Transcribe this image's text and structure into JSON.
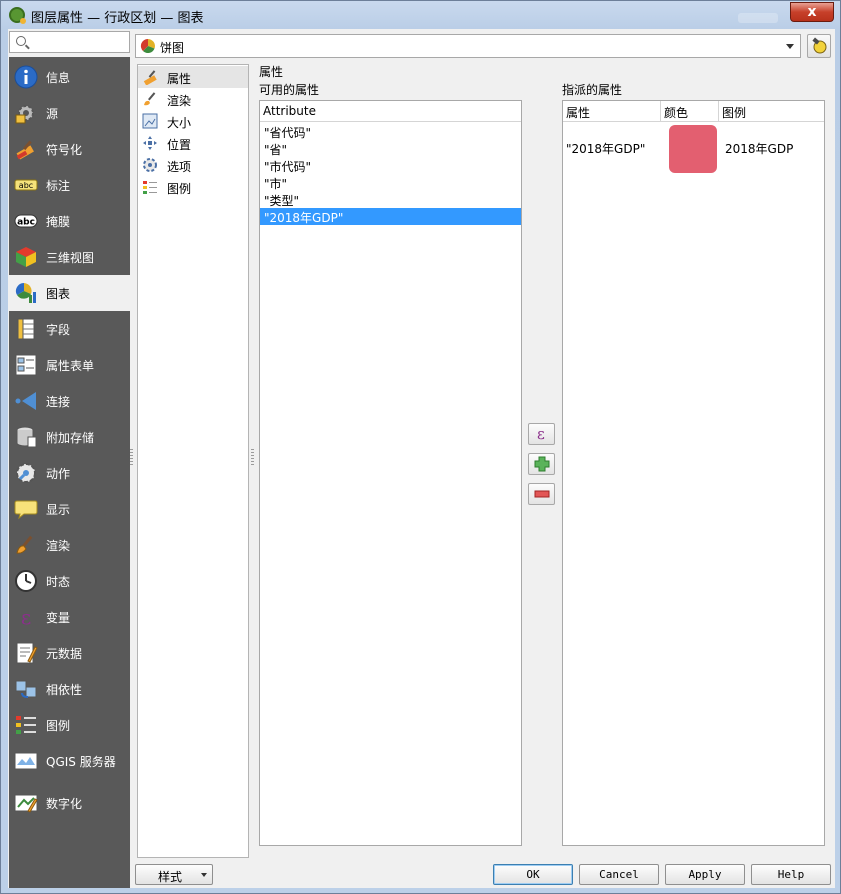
{
  "window": {
    "title": "图层属性 — 行政区划 — 图表",
    "close_label": "x"
  },
  "search": {
    "placeholder": ""
  },
  "sidebar": {
    "items": [
      {
        "label": "信息",
        "icon": "info-icon"
      },
      {
        "label": "源",
        "icon": "source-icon"
      },
      {
        "label": "符号化",
        "icon": "symbology-icon"
      },
      {
        "label": "标注",
        "icon": "labels-icon"
      },
      {
        "label": "掩膜",
        "icon": "mask-icon"
      },
      {
        "label": "三维视图",
        "icon": "3d-view-icon"
      },
      {
        "label": "图表",
        "icon": "diagram-icon"
      },
      {
        "label": "字段",
        "icon": "fields-icon"
      },
      {
        "label": "属性表单",
        "icon": "attributes-form-icon"
      },
      {
        "label": "连接",
        "icon": "joins-icon"
      },
      {
        "label": "附加存储",
        "icon": "auxiliary-storage-icon"
      },
      {
        "label": "动作",
        "icon": "actions-icon"
      },
      {
        "label": "显示",
        "icon": "display-icon"
      },
      {
        "label": "渲染",
        "icon": "rendering-icon"
      },
      {
        "label": "时态",
        "icon": "temporal-icon"
      },
      {
        "label": "变量",
        "icon": "variables-icon"
      },
      {
        "label": "元数据",
        "icon": "metadata-icon"
      },
      {
        "label": "相依性",
        "icon": "dependencies-icon"
      },
      {
        "label": "图例",
        "icon": "legend-icon"
      },
      {
        "label": "QGIS 服务器",
        "icon": "qgis-server-icon"
      },
      {
        "label": "数字化",
        "icon": "digitizing-icon"
      }
    ],
    "active_index": 6
  },
  "diagram_type": {
    "selected": "饼图"
  },
  "subsections": {
    "items": [
      "属性",
      "渲染",
      "大小",
      "位置",
      "选项",
      "图例"
    ],
    "active_index": 0
  },
  "attributes": {
    "section_title": "属性",
    "available_title": "可用的属性",
    "assigned_title": "指派的属性",
    "available_header": "Attribute",
    "available_rows": [
      "\"省代码\"",
      "\"省\"",
      "\"市代码\"",
      "\"市\"",
      "\"类型\"",
      "\"2018年GDP\""
    ],
    "selected_index": 5,
    "assigned_headers": [
      "属性",
      "颜色",
      "图例"
    ],
    "assigned_rows": [
      {
        "attribute": "\"2018年GDP\"",
        "color": "#e35f70",
        "legend": "2018年GDP"
      }
    ],
    "expression_btn": "ε"
  },
  "footer": {
    "style_label": "样式",
    "ok": "OK",
    "cancel": "Cancel",
    "apply": "Apply",
    "help": "Help"
  }
}
